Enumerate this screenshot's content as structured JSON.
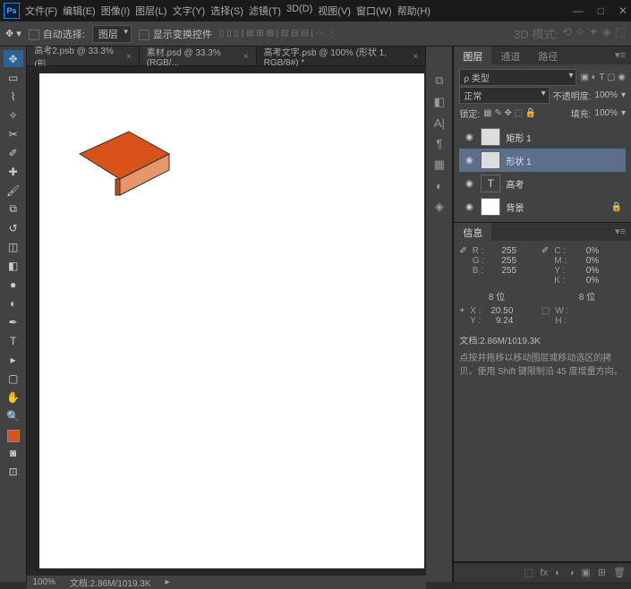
{
  "menu": [
    "文件(F)",
    "编辑(E)",
    "图像(I)",
    "图层(L)",
    "文字(Y)",
    "选择(S)",
    "滤镜(T)",
    "3D(D)",
    "视图(V)",
    "窗口(W)",
    "帮助(H)"
  ],
  "optbar": {
    "autoSelect": "自动选择:",
    "autoSelectMode": "图层",
    "showTransform": "显示变换控件",
    "mode3D": "3D 模式:"
  },
  "tabs": [
    {
      "label": "高考2.psb @ 33.3% (形...",
      "active": false
    },
    {
      "label": "素材.psd @ 33.3%(RGB/...",
      "active": false
    },
    {
      "label": "高考文字.psb @ 100% (形状 1, RGB/8#) *",
      "active": true
    }
  ],
  "status": {
    "zoom": "100%",
    "doc": "文档:2.86M/1019.3K"
  },
  "panels": {
    "layers": {
      "tabs": [
        "图层",
        "通道",
        "路径"
      ],
      "filter": "ρ 类型",
      "blend": "正常",
      "opacityLabel": "不透明度:",
      "opacity": "100%",
      "lockLabel": "锁定:",
      "fillLabel": "填充:",
      "fill": "100%",
      "items": [
        {
          "name": "矩形 1",
          "sel": false,
          "type": "shape"
        },
        {
          "name": "形状 1",
          "sel": true,
          "type": "shape"
        },
        {
          "name": "高考",
          "sel": false,
          "type": "text"
        },
        {
          "name": "背景",
          "sel": false,
          "type": "bg",
          "lock": true
        }
      ]
    },
    "info": {
      "title": "信息",
      "rgb": {
        "R": "255",
        "G": "255",
        "B": "255"
      },
      "cmyk": {
        "C": "0%",
        "M": "0%",
        "Y": "0%",
        "K": "0%"
      },
      "bits": "8 位",
      "bits2": "8 位",
      "xy": {
        "X": "20.50",
        "Y": "9.24"
      },
      "wh": {
        "W": "",
        "H": ""
      },
      "doc": "文档:2.86M/1019.3K",
      "hint": "点按并拖移以移动图层或移动选区的拷贝。使用 Shift 键限制沿 45 度增量方向。"
    }
  },
  "shape_color": "#d95219"
}
